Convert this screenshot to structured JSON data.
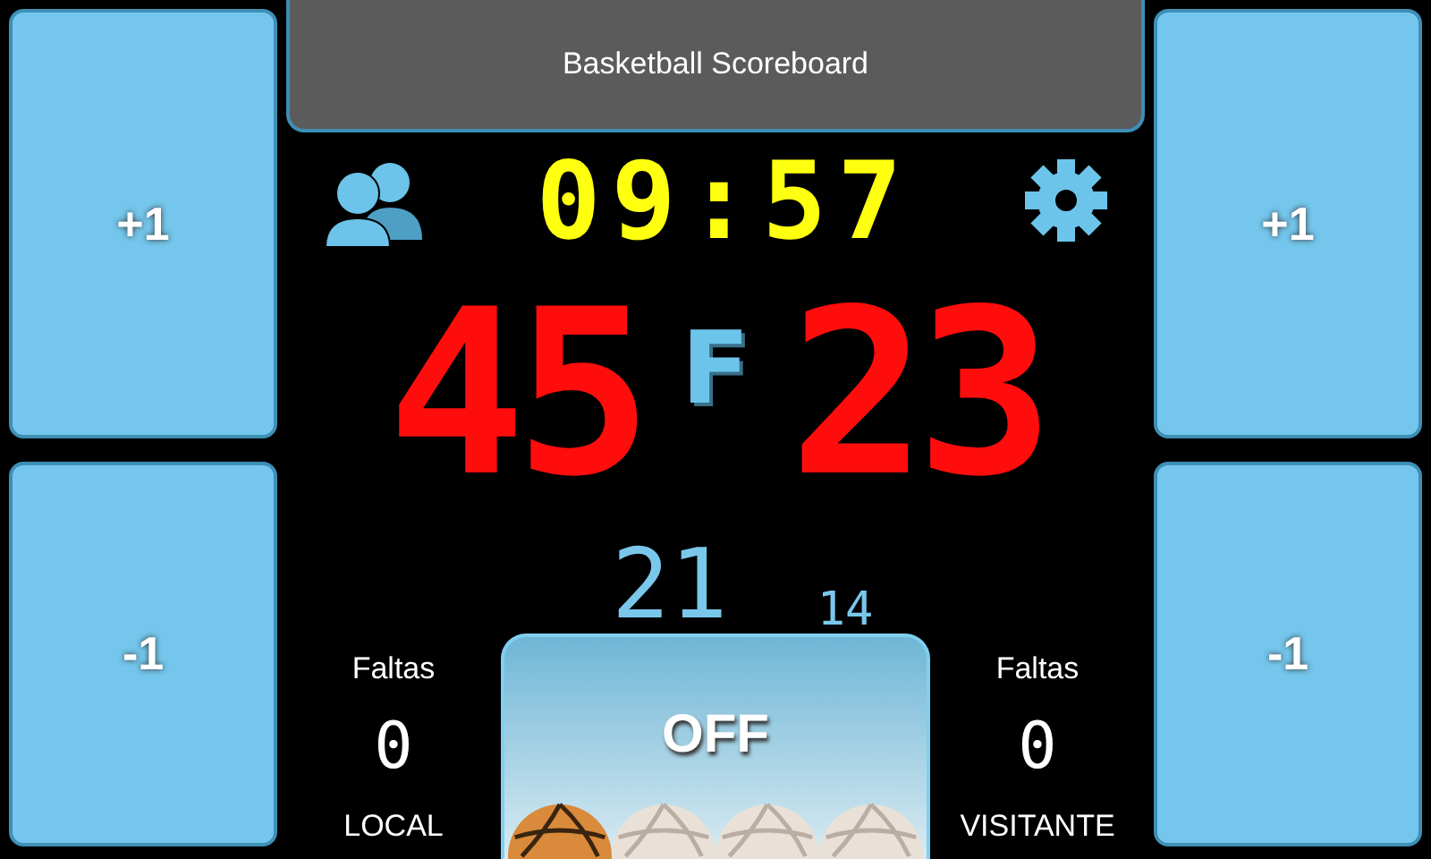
{
  "title": "Basketball Scoreboard",
  "left_buttons": [
    {
      "label": "+1"
    },
    {
      "label": "-1"
    }
  ],
  "right_buttons": [
    {
      "label": "+1"
    },
    {
      "label": "-1"
    }
  ],
  "clock": "09:57",
  "home_score": "45",
  "possession": "F",
  "away_score": "23",
  "counter_large": "21",
  "counter_small": "14",
  "teams": [
    {
      "fouls_label": "Faltas",
      "fouls": "0",
      "name": "LOCAL"
    },
    {
      "fouls_label": "Faltas",
      "fouls": "0",
      "name": "VISITANTE"
    }
  ],
  "toggle": {
    "label": "OFF"
  },
  "balls": [
    {
      "on": true
    },
    {
      "on": false
    },
    {
      "on": false
    },
    {
      "on": false
    }
  ]
}
